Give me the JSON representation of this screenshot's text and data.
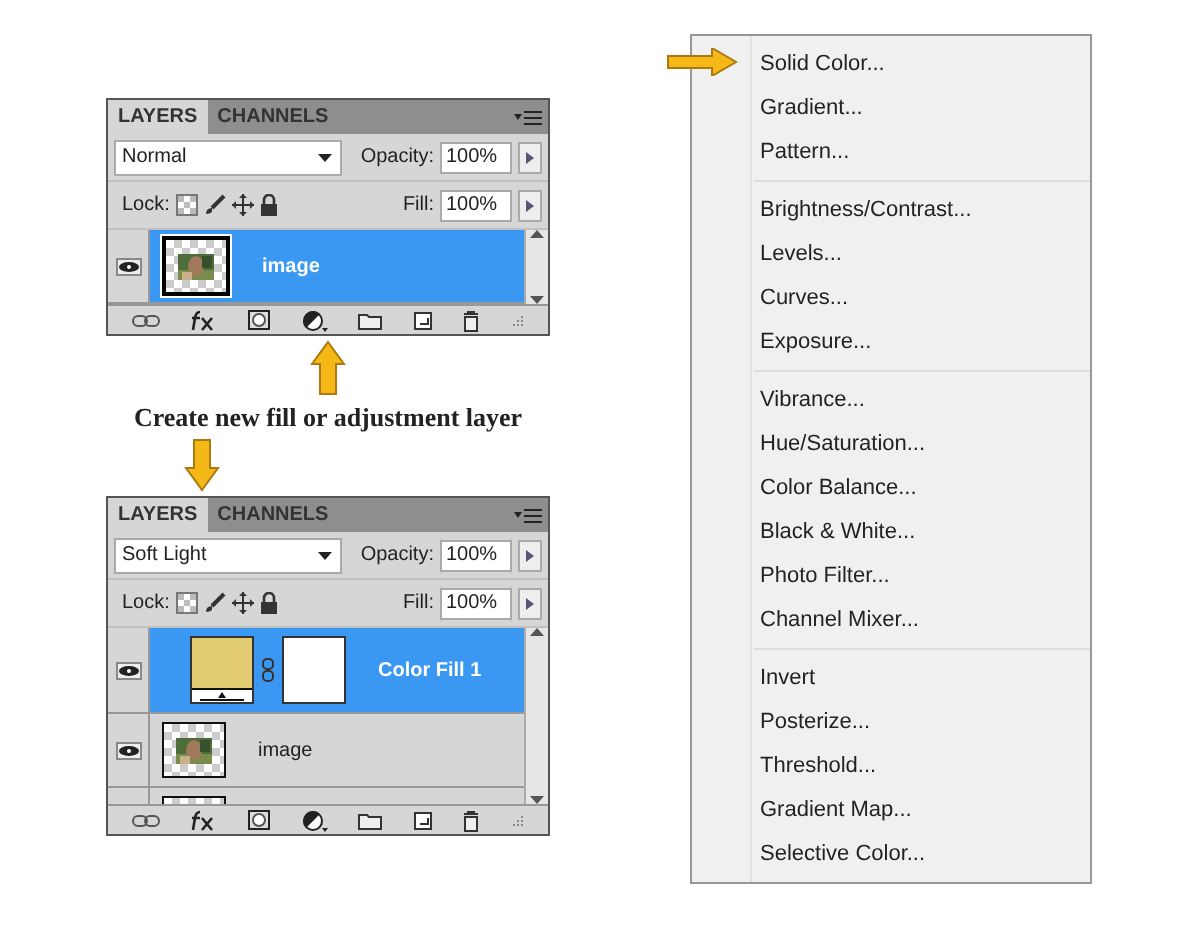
{
  "panels": [
    {
      "tabs": [
        {
          "label": "LAYERS",
          "selected": true
        },
        {
          "label": "CHANNELS",
          "selected": false
        }
      ],
      "blend_mode": "Normal",
      "opacity_label": "Opacity:",
      "opacity": "100%",
      "lock_label": "Lock:",
      "fill_label": "Fill:",
      "fill": "100%",
      "layers": [
        {
          "name": "image",
          "selected": true,
          "visible": true
        }
      ],
      "caption": "Create new fill or adjustment layer"
    },
    {
      "tabs": [
        {
          "label": "LAYERS",
          "selected": true
        },
        {
          "label": "CHANNELS",
          "selected": false
        }
      ],
      "blend_mode": "Soft Light",
      "opacity_label": "Opacity:",
      "opacity": "100%",
      "lock_label": "Lock:",
      "fill_label": "Fill:",
      "fill": "100%",
      "layers": [
        {
          "kind": "fill",
          "name": "Color Fill 1",
          "color": "#e3cb72",
          "selected": true,
          "visible": true
        },
        {
          "name": "image",
          "selected": false,
          "visible": true
        },
        {
          "kind": "transparent",
          "selected": false
        }
      ]
    }
  ],
  "menu": {
    "groups": [
      [
        "Solid Color...",
        "Gradient...",
        "Pattern..."
      ],
      [
        "Brightness/Contrast...",
        "Levels...",
        "Curves...",
        "Exposure..."
      ],
      [
        "Vibrance...",
        "Hue/Saturation...",
        "Color Balance...",
        "Black & White...",
        "Photo Filter...",
        "Channel Mixer..."
      ],
      [
        "Invert",
        "Posterize...",
        "Threshold...",
        "Gradient Map...",
        "Selective Color..."
      ]
    ]
  }
}
